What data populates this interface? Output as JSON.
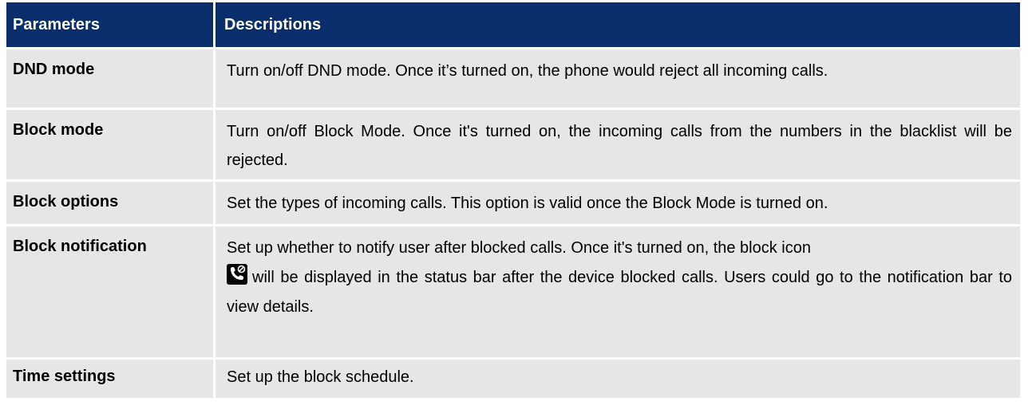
{
  "table": {
    "header": {
      "col1": "Parameters",
      "col2": "Descriptions"
    },
    "rows": [
      {
        "param": "DND mode",
        "desc": "Turn on/off DND mode. Once it’s turned on, the phone would reject all incoming calls."
      },
      {
        "param": "Block mode",
        "desc": "Turn on/off Block Mode. Once it's turned on, the incoming calls from the numbers in the blacklist will be rejected."
      },
      {
        "param": "Block options",
        "desc": "Set the types of incoming calls. This option is valid once the Block Mode is turned on."
      },
      {
        "param": "Block notification",
        "desc_before_icon": "Set up whether to notify user after blocked calls. Once it's turned on, the block icon",
        "icon": "blocked-call-icon",
        "desc_after_icon": "will be displayed in the status bar after the device blocked calls. Users could go to the notification bar to view details."
      },
      {
        "param": "Time settings",
        "desc": "Set up the block schedule."
      }
    ]
  },
  "colors": {
    "header_bg": "#0a2d6b",
    "row_bg": "#e6e6e6"
  }
}
